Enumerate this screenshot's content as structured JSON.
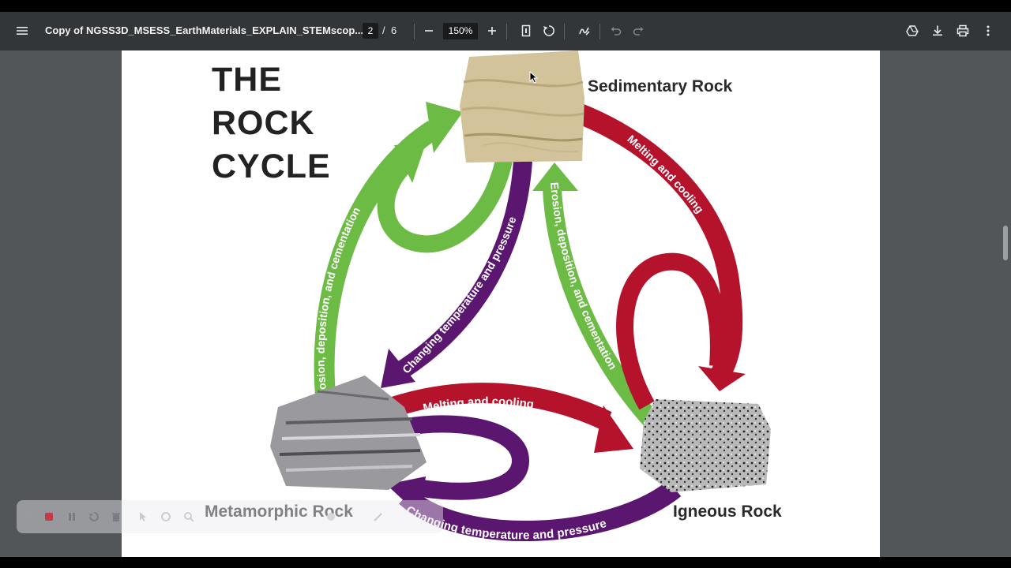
{
  "toolbar": {
    "title": "Copy of NGSS3D_MSESS_EarthMaterials_EXPLAIN_STEMscop...",
    "current_page": "2",
    "page_separator": "/",
    "total_pages": "6",
    "zoom": "150%",
    "icons": [
      "menu-icon",
      "zoom-out-icon",
      "zoom-in-icon",
      "fit-page-icon",
      "rotate-icon",
      "annotate-icon",
      "undo-icon",
      "redo-icon",
      "drive-icon",
      "download-icon",
      "print-icon",
      "more-icon"
    ]
  },
  "diagram": {
    "heading_lines": [
      "THE",
      "ROCK",
      "CYCLE"
    ],
    "rocks": {
      "sedimentary": "Sedimentary Rock",
      "metamorphic": "Metamorphic Rock",
      "igneous": "Igneous Rock"
    },
    "arrows": {
      "erosion_left": "Erosion, deposition, and cementation",
      "erosion_middle": "Erosion, deposition, and cementation",
      "melting_right": "Melting and cooling",
      "melting_bottom": "Melting and cooling",
      "changing_middle": "Changing temperature and pressure",
      "changing_bottom": "Changing temperature and pressure"
    },
    "colors": {
      "green": "#6cbb45",
      "red": "#b5122c",
      "purple": "#5b1670"
    }
  }
}
